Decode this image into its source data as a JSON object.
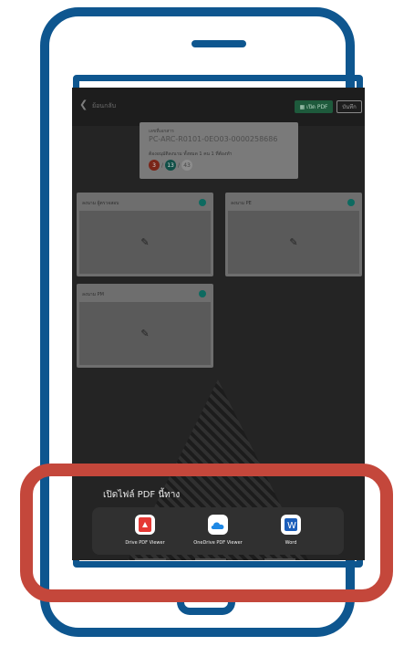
{
  "top_bar": {
    "back_label": "ย้อนกลับ",
    "pdf_button_label": "เปิด PDF",
    "save_button_label": "บันทึก"
  },
  "document_card": {
    "label": "เลขที่เอกสาร",
    "number": "PC-ARC-R0101-0EO03-0000258686",
    "approval_label": "ต้องอนุมัติลงนาม ทั้งหมด 1 คน 1 ที่ต้องทำ",
    "counts": [
      "3",
      "13",
      "43"
    ]
  },
  "signatures": [
    {
      "title": "ลงนาม ผู้ตรวจสอบ"
    },
    {
      "title": "ลงนาม PE"
    },
    {
      "title": "ลงนาม PM"
    }
  ],
  "open_with": {
    "title": "เปิดไฟล์ PDF นี้ทาง",
    "apps": [
      {
        "label": "Drive PDF Viewer",
        "icon": "pdf-viewer-icon",
        "color": "#e53935"
      },
      {
        "label": "OneDrive PDF Viewer",
        "icon": "onedrive-icon",
        "color": "#1e88e5"
      },
      {
        "label": "Word",
        "icon": "word-icon",
        "color": "#1b5eba"
      }
    ]
  },
  "colors": {
    "device_outline": "#0e568f",
    "highlight": "#c4473b",
    "accent_green": "#1e5a3c",
    "toggle_teal": "#0d6a60"
  }
}
